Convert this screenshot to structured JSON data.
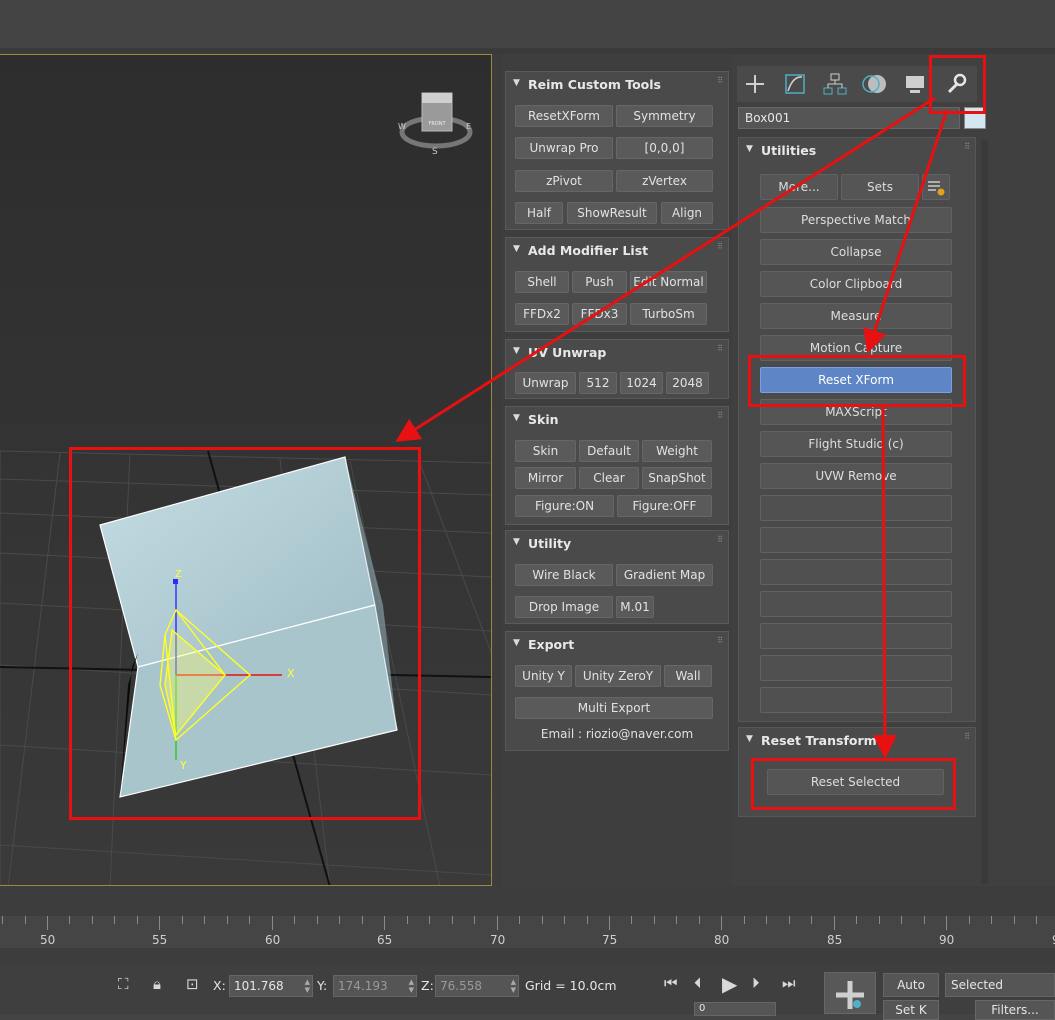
{
  "viewport": {
    "viewcube": {
      "face_label": "FRONT",
      "compass": {
        "west": "W",
        "east": "E",
        "south": "S"
      }
    },
    "gizmo": {
      "x_label": "X",
      "y_label": "Y",
      "z_label": "Z"
    }
  },
  "reim_panel": {
    "rollouts": [
      {
        "title": "Reim Custom Tools",
        "buttons": [
          "ResetXForm",
          "Symmetry",
          "Unwrap Pro",
          "[0,0,0]",
          "zPivot",
          "zVertex",
          "Half",
          "ShowResult",
          "Align"
        ]
      },
      {
        "title": "Add Modifier List",
        "buttons": [
          "Shell",
          "Push",
          "Edit Normal",
          "FFDx2",
          "FFDx3",
          "TurboSm"
        ]
      },
      {
        "title": "UV Unwrap",
        "buttons": [
          "Unwrap",
          "512",
          "1024",
          "2048"
        ]
      },
      {
        "title": "Skin",
        "buttons": [
          "Skin",
          "Default",
          "Weight",
          "Mirror",
          "Clear",
          "SnapShot",
          "Figure:ON",
          "Figure:OFF"
        ]
      },
      {
        "title": "Utility",
        "buttons": [
          "Wire Black",
          "Gradient Map",
          "Drop Image",
          "M.01"
        ]
      },
      {
        "title": "Export",
        "buttons": [
          "Unity Y",
          "Unity ZeroY",
          "Wall",
          "Multi Export"
        ],
        "email": "Email : riozio@naver.com"
      }
    ]
  },
  "command_panel": {
    "tabs": [
      "create-tab",
      "modify-tab",
      "hierarchy-tab",
      "motion-tab",
      "display-tab",
      "utilities-tab"
    ],
    "object_name": "Box001",
    "object_color": "#d5e7ee",
    "utilities": {
      "title": "Utilities",
      "more_label": "More...",
      "sets_label": "Sets",
      "items": [
        "Perspective Match",
        "Collapse",
        "Color Clipboard",
        "Measure",
        "Motion Capture",
        "Reset XForm",
        "MAXScript",
        "Flight Studio (c)",
        "UVW Remove",
        "",
        "",
        "",
        "",
        "",
        "",
        ""
      ],
      "selected_item": "Reset XForm"
    },
    "reset_transform": {
      "title": "Reset Transform",
      "button_label": "Reset Selected"
    }
  },
  "timeline": {
    "ticks": [
      "50",
      "55",
      "60",
      "65",
      "70",
      "75",
      "80",
      "85",
      "90",
      "9"
    ]
  },
  "status_bar": {
    "x_label": "X:",
    "x_value": "101.768",
    "y_label": "Y:",
    "y_value": "174.193",
    "z_label": "Z:",
    "z_value": "76.558",
    "grid": "Grid = 10.0cm",
    "auto_label": "Auto",
    "set_key_label": "Set K",
    "selected_label": "Selected",
    "filters_label": "Filters...",
    "frame_value": "0"
  },
  "colors": {
    "annotation_red": "#e81010",
    "selected_blue": "#5e86c6",
    "viewport_border": "#9b8a3c"
  }
}
